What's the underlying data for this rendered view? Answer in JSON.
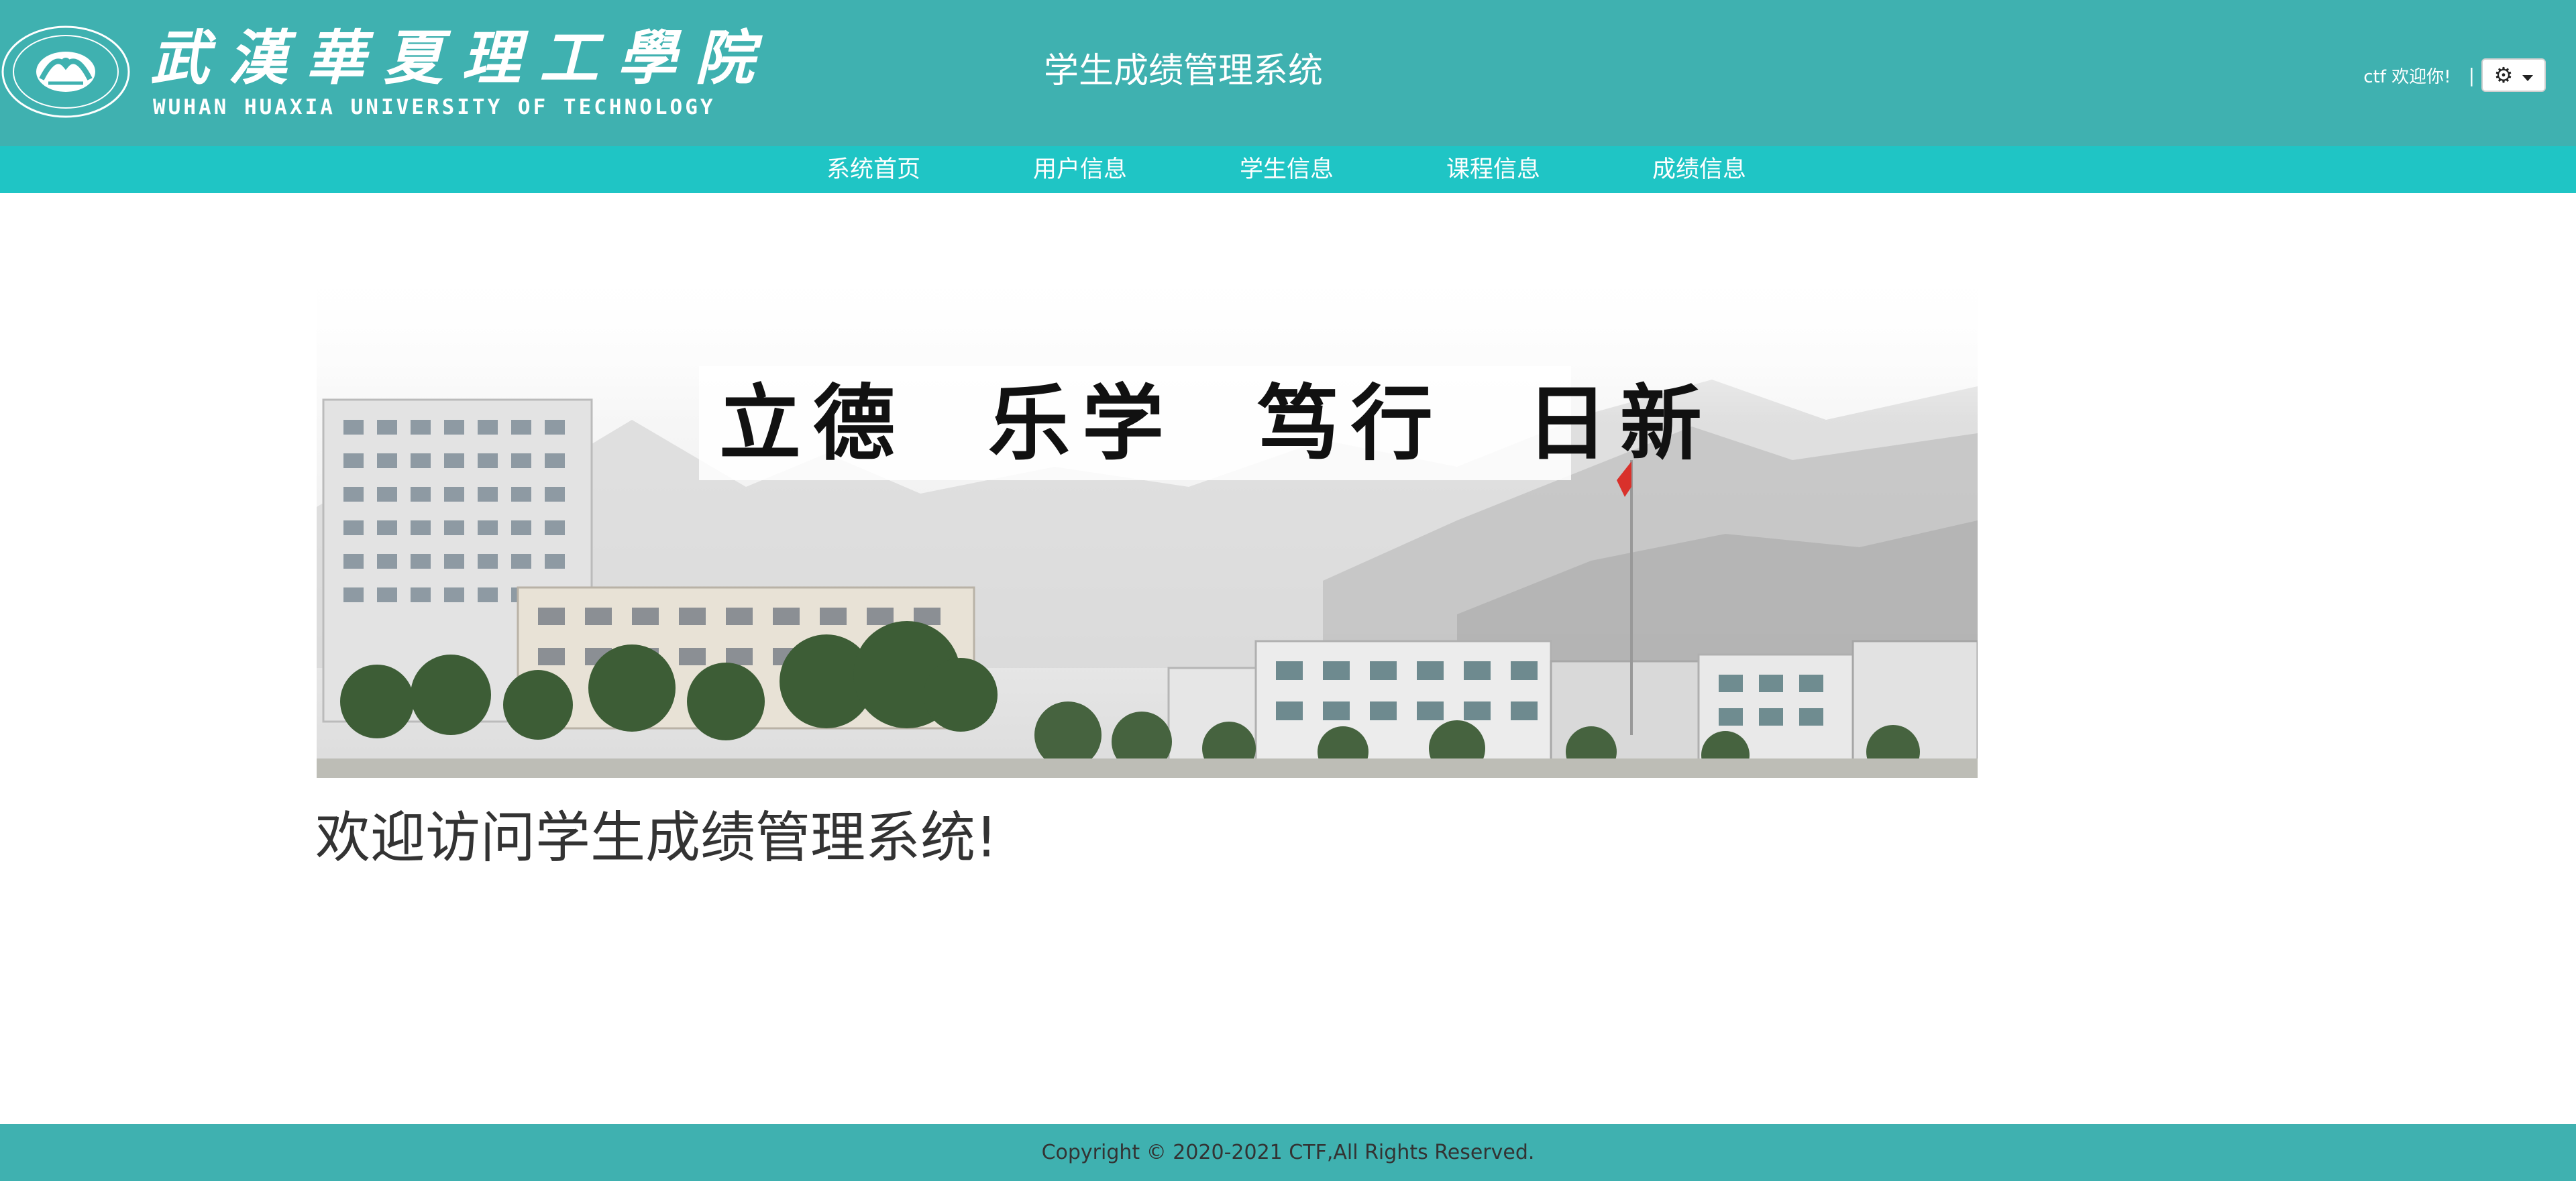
{
  "header": {
    "logo_cn": "武漢華夏理工學院",
    "logo_en": "WUHAN HUAXIA UNIVERSITY OF TECHNOLOGY",
    "system_title": "学生成绩管理系统",
    "welcome_text": "ctf 欢迎你!",
    "separator": "|",
    "settings_icon": "gear-icon",
    "dropdown_icon": "caret-down-icon"
  },
  "nav": {
    "items": [
      {
        "label": "系统首页"
      },
      {
        "label": "用户信息"
      },
      {
        "label": "学生信息"
      },
      {
        "label": "课程信息"
      },
      {
        "label": "成绩信息"
      }
    ]
  },
  "banner": {
    "motto": "立德  乐学  笃行  日新"
  },
  "main": {
    "welcome_heading": "欢迎访问学生成绩管理系统!"
  },
  "footer": {
    "copyright": "Copyright © 2020-2021 CTF,All Rights Reserved."
  },
  "colors": {
    "header_bg": "#3fb1b0",
    "nav_bg": "#1fc5c5",
    "footer_bg": "#3fb1b0",
    "heading_text": "#333333"
  }
}
